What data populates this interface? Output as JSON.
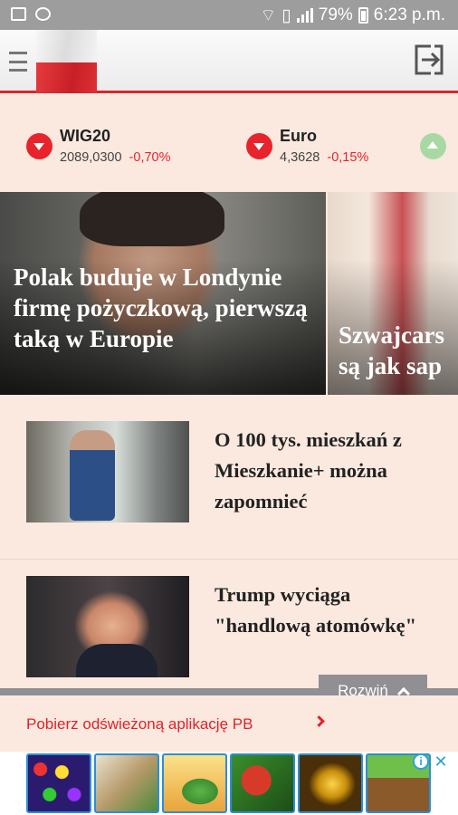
{
  "status_bar": {
    "battery": "79%",
    "time": "6:23 p.m."
  },
  "app_bar": {
    "menu_icon": "hamburger-icon",
    "logo_icon": "polish-flag-icon",
    "logout_icon": "logout-icon"
  },
  "ticker": [
    {
      "name": "WIG20",
      "value": "2089,0300",
      "change": "-0,70%",
      "direction": "down"
    },
    {
      "name": "Euro",
      "value": "4,3628",
      "change": "-0,15%",
      "direction": "down"
    },
    {
      "name": "",
      "value": "",
      "change": "",
      "direction": "up"
    }
  ],
  "hero": [
    {
      "title": "Polak buduje w Londynie firmę pożyczkową, pierwszą taką w Europie"
    },
    {
      "title": "Szwajcarsą jak sap"
    }
  ],
  "articles": [
    {
      "title": "O 100 tys. mieszkań z Mieszkanie+ można zapomnieć"
    },
    {
      "title": "Trump wyciąga \"handlową atomówkę\""
    }
  ],
  "rozwin": {
    "label": "Rozwiń"
  },
  "promo": {
    "label": "Pobierz odświeżoną aplikację PB"
  },
  "ad": {
    "tiles": [
      "",
      "",
      "",
      "",
      "",
      ""
    ],
    "colors": {
      "border": "#2a8fd6",
      "accent": "#e0222b"
    }
  }
}
